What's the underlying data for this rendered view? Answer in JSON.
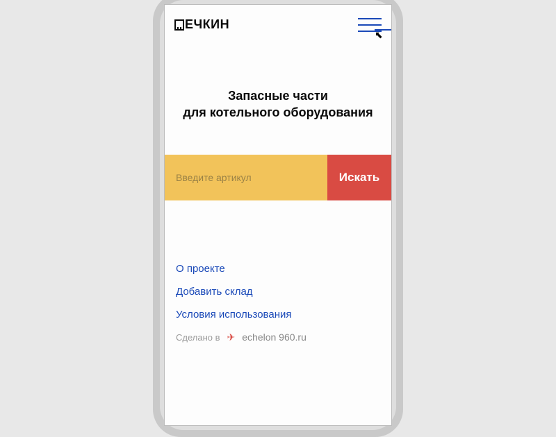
{
  "header": {
    "logo_text": "ЕЧКИН"
  },
  "hero": {
    "line1": "Запасные части",
    "line2": "для котельного оборудования"
  },
  "search": {
    "placeholder": "Введите артикул",
    "button": "Искать"
  },
  "footer": {
    "links": [
      "О проекте",
      "Добавить склад",
      "Условия использования"
    ],
    "madein_label": "Сделано в",
    "madein_brand": "echelon 960.ru"
  }
}
